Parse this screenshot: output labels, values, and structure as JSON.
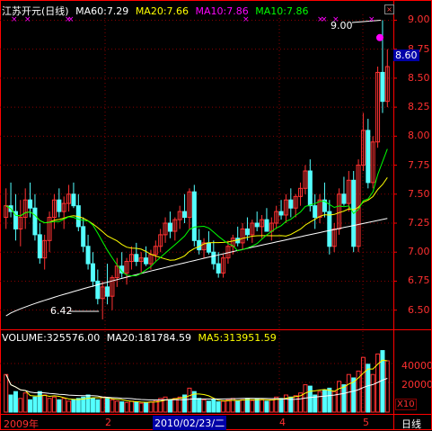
{
  "header": {
    "stock_name": "江苏开元(日线)",
    "ma60": "MA60:7.29",
    "ma20": "MA20:7.66",
    "ma10a": "MA10:7.86",
    "ma10b": "MA10:7.86",
    "close_symbol": "×"
  },
  "colors": {
    "up": "#ff3232",
    "down": "#54ffff",
    "ma60": "#ffffff",
    "ma20": "#ffff00",
    "ma10": "#ff00ff",
    "ma5": "#00ff00",
    "grid": "#880000",
    "axis": "#ff0000"
  },
  "price_axis": {
    "ticks": [
      "9.00",
      "8.75",
      "8.50",
      "8.25",
      "8.00",
      "7.75",
      "7.50",
      "7.25",
      "7.00",
      "6.75",
      "6.50"
    ],
    "min": 6.35,
    "max": 9.05
  },
  "current_price": "8.60",
  "annotations": {
    "high": "9.00",
    "low": "6.42"
  },
  "volume_header": {
    "volume": "VOLUME:325576.00",
    "ma20": "MA20:181784.59",
    "ma5": "MA5:313951.59"
  },
  "volume_axis": {
    "ticks": [
      "40000",
      "20000"
    ],
    "unit": "X10"
  },
  "time_axis": {
    "year": "2009年",
    "m2": "2",
    "cursor": "2010/02/23/二",
    "m4": "4",
    "m5": "5"
  },
  "period_label": "日线",
  "chart_data": {
    "type": "candlestick",
    "candles": [
      [
        7.3,
        7.55,
        7.2,
        7.4
      ],
      [
        7.4,
        7.6,
        7.3,
        7.35
      ],
      [
        7.35,
        7.5,
        7.1,
        7.2
      ],
      [
        7.2,
        7.45,
        7.05,
        7.3
      ],
      [
        7.3,
        7.55,
        7.2,
        7.45
      ],
      [
        7.45,
        7.6,
        7.3,
        7.38
      ],
      [
        7.38,
        7.5,
        7.1,
        7.15
      ],
      [
        7.15,
        7.25,
        6.9,
        6.95
      ],
      [
        6.95,
        7.15,
        6.85,
        7.1
      ],
      [
        7.1,
        7.35,
        7.0,
        7.3
      ],
      [
        7.3,
        7.5,
        7.2,
        7.45
      ],
      [
        7.45,
        7.55,
        7.3,
        7.35
      ],
      [
        7.35,
        7.48,
        7.2,
        7.42
      ],
      [
        7.42,
        7.58,
        7.35,
        7.5
      ],
      [
        7.5,
        7.6,
        7.38,
        7.4
      ],
      [
        7.4,
        7.5,
        7.18,
        7.22
      ],
      [
        7.22,
        7.3,
        7.0,
        7.05
      ],
      [
        7.05,
        7.15,
        6.85,
        6.9
      ],
      [
        6.9,
        7.0,
        6.7,
        6.75
      ],
      [
        6.75,
        6.85,
        6.55,
        6.6
      ],
      [
        6.6,
        6.75,
        6.42,
        6.7
      ],
      [
        6.7,
        6.9,
        6.55,
        6.62
      ],
      [
        6.62,
        6.8,
        6.5,
        6.78
      ],
      [
        6.78,
        6.95,
        6.7,
        6.88
      ],
      [
        6.88,
        7.0,
        6.78,
        6.82
      ],
      [
        6.82,
        6.95,
        6.72,
        6.92
      ],
      [
        6.92,
        7.05,
        6.85,
        6.98
      ],
      [
        6.98,
        7.08,
        6.88,
        6.92
      ],
      [
        6.92,
        7.0,
        6.82,
        6.95
      ],
      [
        6.95,
        7.05,
        6.88,
        6.9
      ],
      [
        6.9,
        7.02,
        6.85,
        6.98
      ],
      [
        6.98,
        7.1,
        6.92,
        7.05
      ],
      [
        7.05,
        7.2,
        7.0,
        7.15
      ],
      [
        7.15,
        7.3,
        7.08,
        7.25
      ],
      [
        7.25,
        7.35,
        7.12,
        7.18
      ],
      [
        7.18,
        7.3,
        7.1,
        7.28
      ],
      [
        7.28,
        7.4,
        7.2,
        7.35
      ],
      [
        7.35,
        7.5,
        7.25,
        7.3
      ],
      [
        7.3,
        7.55,
        7.2,
        7.52
      ],
      [
        7.52,
        7.58,
        7.05,
        7.1
      ],
      [
        7.1,
        7.2,
        6.98,
        7.02
      ],
      [
        7.02,
        7.12,
        6.95,
        7.08
      ],
      [
        7.08,
        7.18,
        6.98,
        7.0
      ],
      [
        7.0,
        7.1,
        6.85,
        6.9
      ],
      [
        6.9,
        7.0,
        6.78,
        6.82
      ],
      [
        6.82,
        6.98,
        6.78,
        6.95
      ],
      [
        6.95,
        7.1,
        6.9,
        7.05
      ],
      [
        7.05,
        7.15,
        6.98,
        7.12
      ],
      [
        7.12,
        7.22,
        7.05,
        7.08
      ],
      [
        7.08,
        7.25,
        7.02,
        7.2
      ],
      [
        7.2,
        7.3,
        7.1,
        7.15
      ],
      [
        7.15,
        7.28,
        7.08,
        7.25
      ],
      [
        7.25,
        7.35,
        7.18,
        7.22
      ],
      [
        7.22,
        7.32,
        7.12,
        7.28
      ],
      [
        7.28,
        7.38,
        7.2,
        7.18
      ],
      [
        7.18,
        7.3,
        7.1,
        7.25
      ],
      [
        7.25,
        7.4,
        7.2,
        7.35
      ],
      [
        7.35,
        7.45,
        7.28,
        7.32
      ],
      [
        7.32,
        7.5,
        7.25,
        7.45
      ],
      [
        7.45,
        7.55,
        7.3,
        7.38
      ],
      [
        7.38,
        7.5,
        7.3,
        7.48
      ],
      [
        7.48,
        7.6,
        7.4,
        7.55
      ],
      [
        7.55,
        7.75,
        7.5,
        7.7
      ],
      [
        7.7,
        7.8,
        7.35,
        7.4
      ],
      [
        7.4,
        7.5,
        7.2,
        7.3
      ],
      [
        7.3,
        7.5,
        7.25,
        7.45
      ],
      [
        7.45,
        7.6,
        7.3,
        7.35
      ],
      [
        7.35,
        7.45,
        6.98,
        7.05
      ],
      [
        7.05,
        7.25,
        7.0,
        7.2
      ],
      [
        7.2,
        7.55,
        7.15,
        7.5
      ],
      [
        7.5,
        7.65,
        7.4,
        7.42
      ],
      [
        7.42,
        7.7,
        7.35,
        7.62
      ],
      [
        7.62,
        7.7,
        7.0,
        7.05
      ],
      [
        7.05,
        7.8,
        7.0,
        7.75
      ],
      [
        7.75,
        8.2,
        7.7,
        8.05
      ],
      [
        8.05,
        8.15,
        7.55,
        7.6
      ],
      [
        7.6,
        8.0,
        7.55,
        7.95
      ],
      [
        7.95,
        8.6,
        7.9,
        8.55
      ],
      [
        8.55,
        9.0,
        8.2,
        8.3
      ],
      [
        8.3,
        8.75,
        8.25,
        8.6
      ]
    ],
    "volume": [
      0.55,
      0.25,
      0.3,
      0.2,
      0.28,
      0.18,
      0.22,
      0.3,
      0.25,
      0.2,
      0.22,
      0.18,
      0.2,
      0.16,
      0.18,
      0.2,
      0.22,
      0.25,
      0.2,
      0.18,
      0.22,
      0.2,
      0.18,
      0.16,
      0.15,
      0.14,
      0.16,
      0.15,
      0.13,
      0.14,
      0.15,
      0.17,
      0.2,
      0.22,
      0.18,
      0.2,
      0.22,
      0.25,
      0.35,
      0.3,
      0.2,
      0.18,
      0.16,
      0.18,
      0.15,
      0.16,
      0.18,
      0.2,
      0.16,
      0.18,
      0.2,
      0.17,
      0.19,
      0.18,
      0.16,
      0.18,
      0.22,
      0.2,
      0.25,
      0.22,
      0.24,
      0.28,
      0.4,
      0.38,
      0.25,
      0.3,
      0.32,
      0.35,
      0.3,
      0.45,
      0.4,
      0.55,
      0.5,
      0.6,
      0.8,
      0.7,
      0.55,
      0.85,
      0.9,
      0.75
    ],
    "ylim": [
      6.35,
      9.05
    ]
  }
}
